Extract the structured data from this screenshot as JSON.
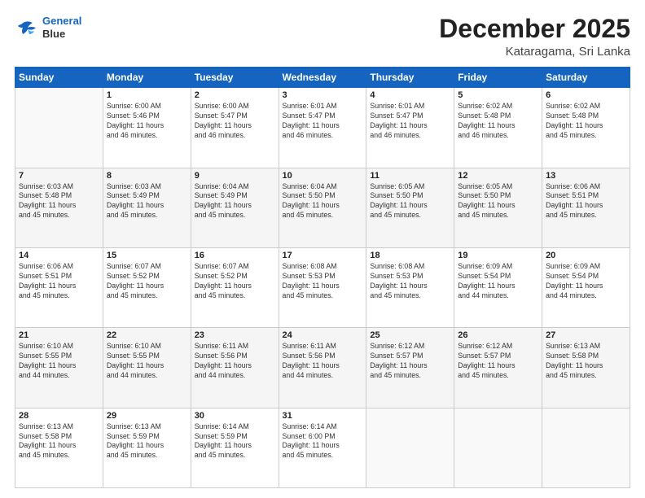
{
  "logo": {
    "line1": "General",
    "line2": "Blue"
  },
  "title": "December 2025",
  "subtitle": "Kataragama, Sri Lanka",
  "days_header": [
    "Sunday",
    "Monday",
    "Tuesday",
    "Wednesday",
    "Thursday",
    "Friday",
    "Saturday"
  ],
  "weeks": [
    [
      {
        "num": "",
        "info": ""
      },
      {
        "num": "1",
        "info": "Sunrise: 6:00 AM\nSunset: 5:46 PM\nDaylight: 11 hours\nand 46 minutes."
      },
      {
        "num": "2",
        "info": "Sunrise: 6:00 AM\nSunset: 5:47 PM\nDaylight: 11 hours\nand 46 minutes."
      },
      {
        "num": "3",
        "info": "Sunrise: 6:01 AM\nSunset: 5:47 PM\nDaylight: 11 hours\nand 46 minutes."
      },
      {
        "num": "4",
        "info": "Sunrise: 6:01 AM\nSunset: 5:47 PM\nDaylight: 11 hours\nand 46 minutes."
      },
      {
        "num": "5",
        "info": "Sunrise: 6:02 AM\nSunset: 5:48 PM\nDaylight: 11 hours\nand 46 minutes."
      },
      {
        "num": "6",
        "info": "Sunrise: 6:02 AM\nSunset: 5:48 PM\nDaylight: 11 hours\nand 45 minutes."
      }
    ],
    [
      {
        "num": "7",
        "info": "Sunrise: 6:03 AM\nSunset: 5:48 PM\nDaylight: 11 hours\nand 45 minutes."
      },
      {
        "num": "8",
        "info": "Sunrise: 6:03 AM\nSunset: 5:49 PM\nDaylight: 11 hours\nand 45 minutes."
      },
      {
        "num": "9",
        "info": "Sunrise: 6:04 AM\nSunset: 5:49 PM\nDaylight: 11 hours\nand 45 minutes."
      },
      {
        "num": "10",
        "info": "Sunrise: 6:04 AM\nSunset: 5:50 PM\nDaylight: 11 hours\nand 45 minutes."
      },
      {
        "num": "11",
        "info": "Sunrise: 6:05 AM\nSunset: 5:50 PM\nDaylight: 11 hours\nand 45 minutes."
      },
      {
        "num": "12",
        "info": "Sunrise: 6:05 AM\nSunset: 5:50 PM\nDaylight: 11 hours\nand 45 minutes."
      },
      {
        "num": "13",
        "info": "Sunrise: 6:06 AM\nSunset: 5:51 PM\nDaylight: 11 hours\nand 45 minutes."
      }
    ],
    [
      {
        "num": "14",
        "info": "Sunrise: 6:06 AM\nSunset: 5:51 PM\nDaylight: 11 hours\nand 45 minutes."
      },
      {
        "num": "15",
        "info": "Sunrise: 6:07 AM\nSunset: 5:52 PM\nDaylight: 11 hours\nand 45 minutes."
      },
      {
        "num": "16",
        "info": "Sunrise: 6:07 AM\nSunset: 5:52 PM\nDaylight: 11 hours\nand 45 minutes."
      },
      {
        "num": "17",
        "info": "Sunrise: 6:08 AM\nSunset: 5:53 PM\nDaylight: 11 hours\nand 45 minutes."
      },
      {
        "num": "18",
        "info": "Sunrise: 6:08 AM\nSunset: 5:53 PM\nDaylight: 11 hours\nand 45 minutes."
      },
      {
        "num": "19",
        "info": "Sunrise: 6:09 AM\nSunset: 5:54 PM\nDaylight: 11 hours\nand 44 minutes."
      },
      {
        "num": "20",
        "info": "Sunrise: 6:09 AM\nSunset: 5:54 PM\nDaylight: 11 hours\nand 44 minutes."
      }
    ],
    [
      {
        "num": "21",
        "info": "Sunrise: 6:10 AM\nSunset: 5:55 PM\nDaylight: 11 hours\nand 44 minutes."
      },
      {
        "num": "22",
        "info": "Sunrise: 6:10 AM\nSunset: 5:55 PM\nDaylight: 11 hours\nand 44 minutes."
      },
      {
        "num": "23",
        "info": "Sunrise: 6:11 AM\nSunset: 5:56 PM\nDaylight: 11 hours\nand 44 minutes."
      },
      {
        "num": "24",
        "info": "Sunrise: 6:11 AM\nSunset: 5:56 PM\nDaylight: 11 hours\nand 44 minutes."
      },
      {
        "num": "25",
        "info": "Sunrise: 6:12 AM\nSunset: 5:57 PM\nDaylight: 11 hours\nand 45 minutes."
      },
      {
        "num": "26",
        "info": "Sunrise: 6:12 AM\nSunset: 5:57 PM\nDaylight: 11 hours\nand 45 minutes."
      },
      {
        "num": "27",
        "info": "Sunrise: 6:13 AM\nSunset: 5:58 PM\nDaylight: 11 hours\nand 45 minutes."
      }
    ],
    [
      {
        "num": "28",
        "info": "Sunrise: 6:13 AM\nSunset: 5:58 PM\nDaylight: 11 hours\nand 45 minutes."
      },
      {
        "num": "29",
        "info": "Sunrise: 6:13 AM\nSunset: 5:59 PM\nDaylight: 11 hours\nand 45 minutes."
      },
      {
        "num": "30",
        "info": "Sunrise: 6:14 AM\nSunset: 5:59 PM\nDaylight: 11 hours\nand 45 minutes."
      },
      {
        "num": "31",
        "info": "Sunrise: 6:14 AM\nSunset: 6:00 PM\nDaylight: 11 hours\nand 45 minutes."
      },
      {
        "num": "",
        "info": ""
      },
      {
        "num": "",
        "info": ""
      },
      {
        "num": "",
        "info": ""
      }
    ]
  ]
}
